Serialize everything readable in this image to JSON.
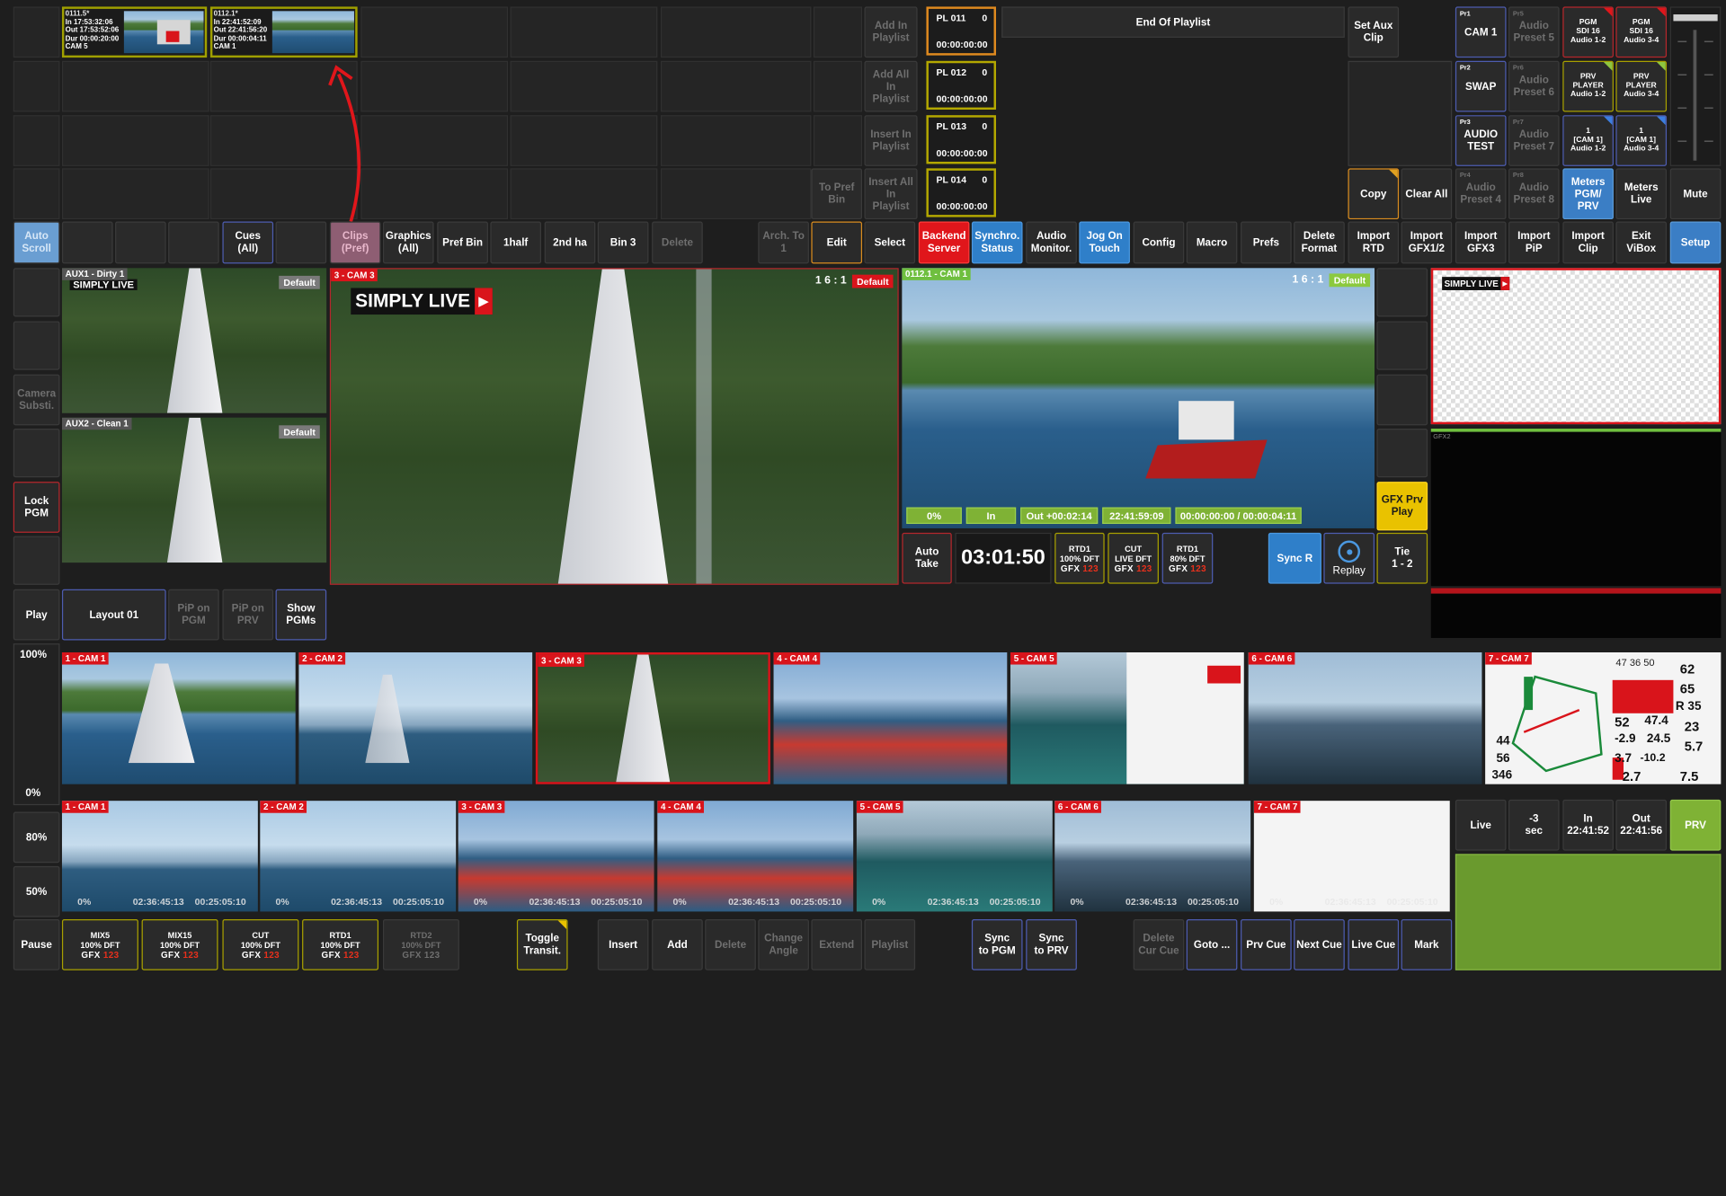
{
  "playlist_clips": [
    {
      "name": "0111.5*",
      "in": "In    17:53:32:06",
      "out": "Out  17:53:52:06",
      "dur": "Dur  00:00:20:00",
      "cam": "CAM 5"
    },
    {
      "name": "0112.1*",
      "in": "In    22:41:52:09",
      "out": "Out  22:41:56:20",
      "dur": "Dur  00:00:04:11",
      "cam": "CAM 1"
    }
  ],
  "clip_actions": {
    "add_in_playlist": "Add In\nPlaylist",
    "add_all_in_playlist": "Add All\nIn\nPlaylist",
    "insert_in_playlist": "Insert In\nPlaylist",
    "insert_all_in_playlist": "Insert All\nIn\nPlaylist",
    "to_pref_bin": "To Pref\nBin"
  },
  "playlists": [
    {
      "name": "PL 011",
      "count": "0",
      "time": "00:00:00:00"
    },
    {
      "name": "PL 012",
      "count": "0",
      "time": "00:00:00:00"
    },
    {
      "name": "PL 013",
      "count": "0",
      "time": "00:00:00:00"
    },
    {
      "name": "PL 014",
      "count": "0",
      "time": "00:00:00:00"
    }
  ],
  "end_of_playlist": "End Of Playlist",
  "right_top": {
    "set_aux_clip": "Set Aux\nClip",
    "copy": "Copy",
    "clear_all": "Clear All",
    "pr1_tag": "Pr1",
    "pr1": "CAM 1",
    "pr2_tag": "Pr2",
    "pr2": "SWAP",
    "pr3_tag": "Pr3",
    "pr3": "AUDIO\nTEST",
    "pr4_tag": "Pr4",
    "pr4": "Audio\nPreset 4",
    "pr5_tag": "Pr5",
    "pr5": "Audio\nPreset 5",
    "pr6_tag": "Pr6",
    "pr6": "Audio\nPreset 6",
    "pr7_tag": "Pr7",
    "pr7": "Audio\nPreset 7",
    "pr8_tag": "Pr8",
    "pr8": "Audio\nPreset 8",
    "pgm_sdi_12": "PGM\nSDI 16\nAudio 1-2",
    "pgm_sdi_34": "PGM\nSDI 16\nAudio 3-4",
    "prv_player_12": "PRV\nPLAYER\nAudio 1-2",
    "prv_player_34": "PRV\nPLAYER\nAudio 3-4",
    "cam1_12": "1\n[CAM 1]\nAudio 1-2",
    "cam1_34": "1\n[CAM 1]\nAudio 3-4",
    "meters_pgm": "Meters\nPGM/\nPRV",
    "meters_live": "Meters\nLive",
    "mute": "Mute"
  },
  "toolbar": {
    "auto_scroll": "Auto\nScroll",
    "cues": "Cues\n(All)",
    "clips_pref": "Clips\n(Pref)",
    "graphics_all": "Graphics\n(All)",
    "pref_bin": "Pref Bin",
    "half1": "1half",
    "half2": "2nd ha",
    "bin3": "Bin 3",
    "delete": "Delete",
    "arch_to": "Arch. To\n1",
    "edit": "Edit",
    "select": "Select",
    "backend_server": "Backend\nServer",
    "synchro_status": "Synchro.\nStatus",
    "audio_monitor": "Audio\nMonitor.",
    "jog_on_touch": "Jog On\nTouch",
    "config": "Config",
    "macro": "Macro",
    "prefs": "Prefs",
    "delete_format": "Delete\nFormat",
    "import_rtd": "Import\nRTD",
    "import_gfx12": "Import\nGFX1/2",
    "import_gfx3": "Import\nGFX3",
    "import_pip": "Import\nPiP",
    "import_clip": "Import\nClip",
    "exit_vibox": "Exit\nViBox",
    "setup": "Setup"
  },
  "left_col": {
    "camera_subst": "Camera\nSubsti.",
    "lock_pgm": "Lock\nPGM",
    "play": "Play",
    "pct_100": "100%",
    "pct_0": "0%",
    "pct_80": "80%",
    "pct_50": "50%",
    "pause": "Pause"
  },
  "aux": {
    "aux1": "AUX1 - Dirty 1",
    "aux1_default": "Default",
    "aux2": "AUX2 - Clean 1",
    "aux2_default": "Default"
  },
  "pgm": {
    "label": "3 - CAM 3",
    "ratio": "1 6 : 1",
    "default": "Default",
    "logo": "SIMPLY LIVE"
  },
  "prv": {
    "label": "0112.1 - CAM 1",
    "ratio": "1 6 : 1",
    "default": "Default",
    "pct": "0%",
    "in": "In",
    "out": "Out +00:02:14",
    "time": "22:41:59:09",
    "dur": "00:00:00:00 / 00:00:04:11"
  },
  "transport": {
    "auto_take": "Auto\nTake",
    "clock": "03:01:50",
    "rtd1_a": "RTD1\n100% DFT",
    "cut": "CUT\nLIVE DFT",
    "rtd1_b": "RTD1\n80% DFT",
    "gfx": "GFX",
    "gfx_nums": "123",
    "sync_r": "Sync R",
    "replay": "Replay",
    "tie": "Tie\n1 - 2",
    "gfx_prv_play": "GFX Prv\nPlay"
  },
  "gfx_preview": {
    "logo": "SIMPLY LIVE",
    "gfx2": "GFX2"
  },
  "layout_row": {
    "layout": "Layout 01",
    "pip_pgm": "PiP on\nPGM",
    "pip_prv": "PiP on\nPRV",
    "show_pgms": "Show\nPGMs"
  },
  "cams_top": [
    "1 - CAM 1",
    "2 - CAM 2",
    "3 - CAM 3",
    "4 - CAM 4",
    "5 - CAM 5",
    "6 - CAM 6",
    "7 - CAM 7"
  ],
  "cams_bottom": [
    "1 - CAM 1",
    "2 - CAM 2",
    "3 - CAM 3",
    "4 - CAM 4",
    "5 - CAM 5",
    "6 - CAM 6",
    "7 - CAM 7"
  ],
  "bottom_tc": {
    "pct": "0%",
    "a": "02:36:45:13",
    "b": "00:25:05:10"
  },
  "telemetry": {
    "v1": "62",
    "v2": "65",
    "v3": "R 35",
    "v4": "52",
    "v5": "47.4",
    "v6": "23",
    "v7": "-2.9",
    "v8": "24.5",
    "v9": "5.7",
    "v10": "3.7",
    "v11": "-10.2",
    "v12": "44",
    "v13": "56",
    "v14": "346",
    "v15": "2.7",
    "v16": "7.5",
    "top1": "47",
    "top2": "36",
    "top3": "50"
  },
  "live_panel": {
    "live": "Live",
    "minus3": "-3\nsec",
    "in": "In\n22:41:52",
    "out": "Out\n22:41:56",
    "prv": "PRV"
  },
  "bottom_bar": {
    "mix5": "MIX5\n100% DFT",
    "mix15": "MIX15\n100% DFT",
    "cut": "CUT\n100% DFT",
    "rtd1": "RTD1\n100% DFT",
    "rtd2": "RTD2\n100% DFT",
    "toggle": "Toggle\nTransit.",
    "insert": "Insert",
    "add": "Add",
    "delete": "Delete",
    "change_angle": "Change\nAngle",
    "extend": "Extend",
    "playlist": "Playlist",
    "sync_pgm": "Sync\nto PGM",
    "sync_prv": "Sync\nto PRV",
    "delete_cur_cue": "Delete\nCur Cue",
    "goto": "Goto ...",
    "prv_cue": "Prv Cue",
    "next_cue": "Next Cue",
    "live_cue": "Live Cue",
    "mark": "Mark"
  }
}
